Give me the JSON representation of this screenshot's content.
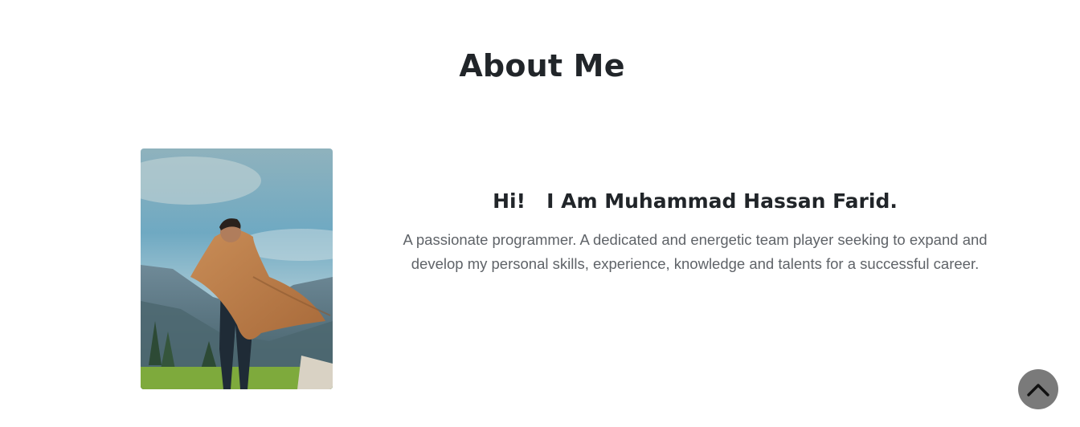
{
  "about": {
    "title": "About Me",
    "greeting": "Hi!   I Am Muhammad Hassan Farid.",
    "bio": "A passionate programmer. A dedicated and energetic team player seeking to expand and develop my personal skills, experience, knowledge and talents for a successful career."
  },
  "icons": {
    "back_to_top": "chevron-up-icon"
  },
  "colors": {
    "heading": "#212529",
    "body_text": "#5f6368",
    "back_to_top_bg": "#7a7a7a",
    "background": "#ffffff"
  }
}
